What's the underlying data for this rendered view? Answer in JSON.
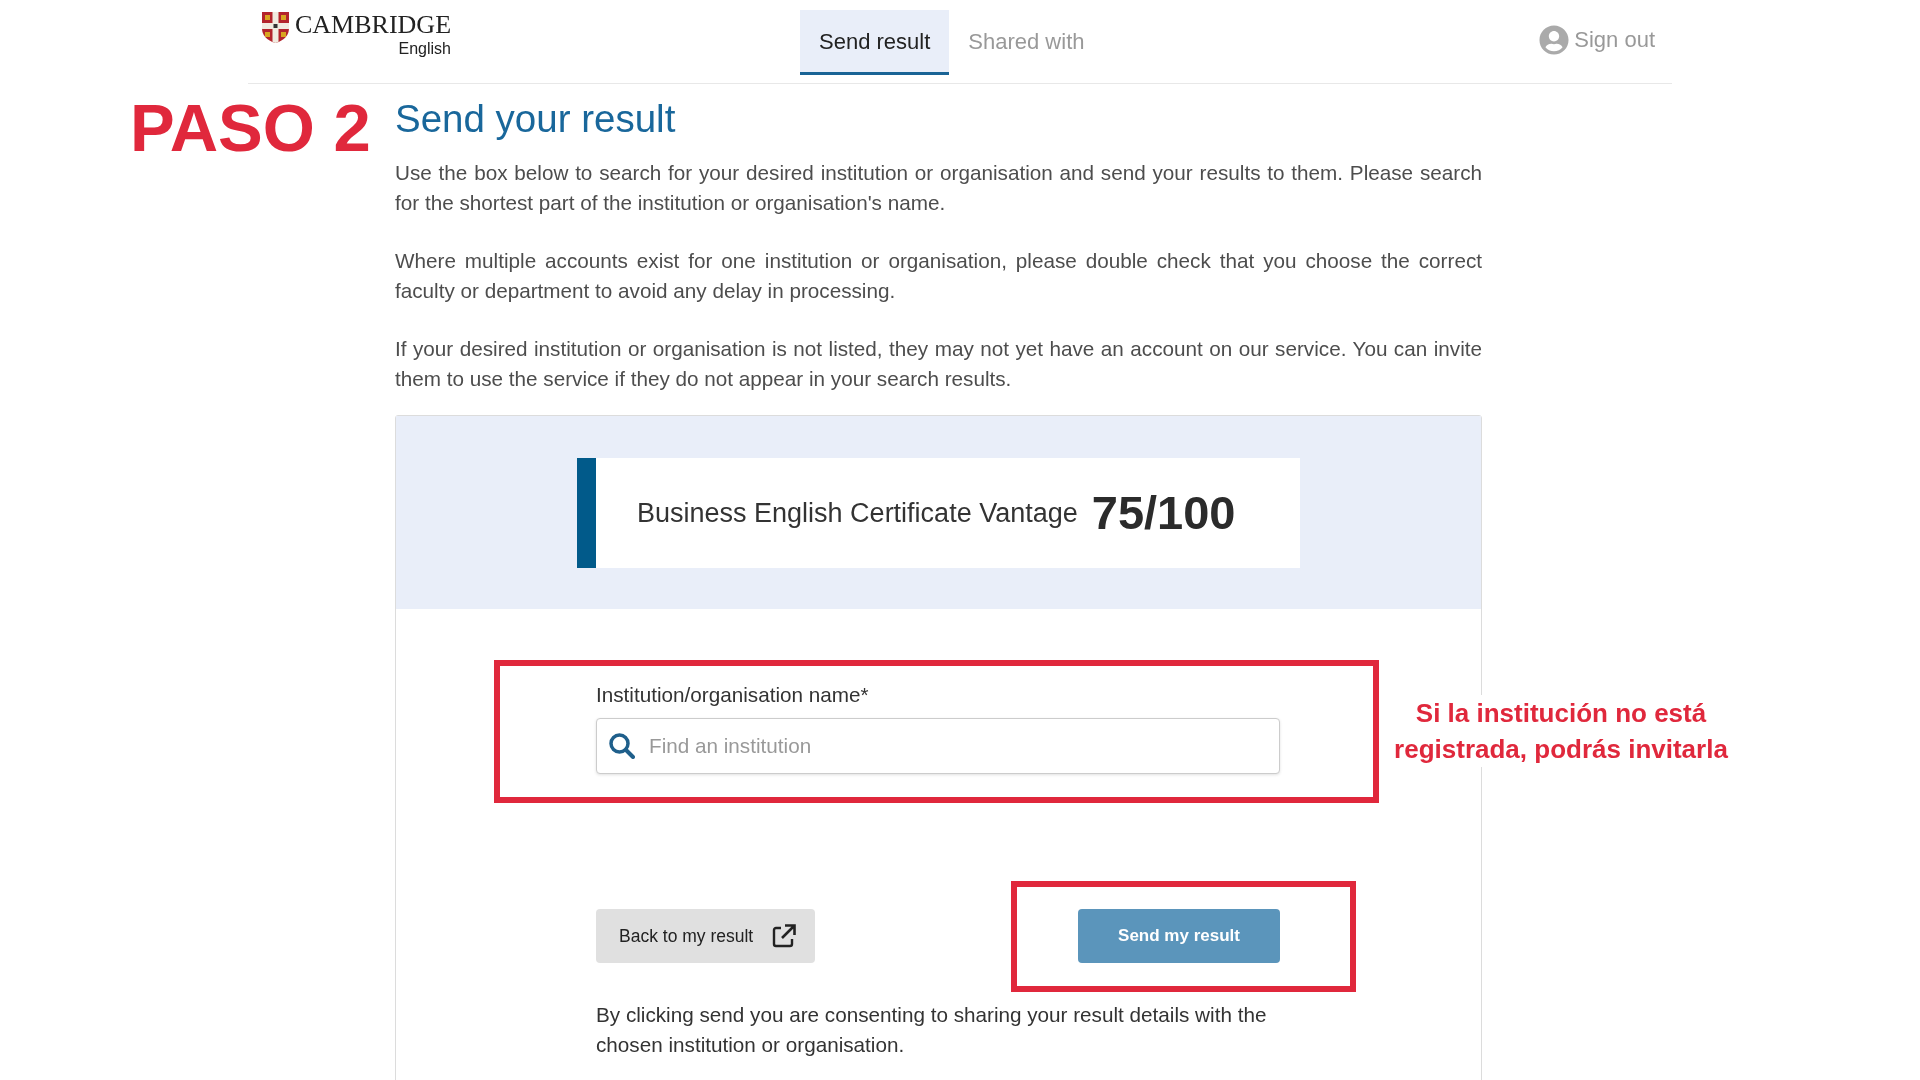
{
  "header": {
    "logo": {
      "name": "CAMBRIDGE",
      "subtitle": "English"
    },
    "tabs": [
      {
        "label": "Send result",
        "selected": true
      },
      {
        "label": "Shared with",
        "selected": false
      }
    ],
    "sign_out": "Sign out"
  },
  "annotations": {
    "step_label": "PASO 2",
    "note": "Si la institución no está registrada, podrás invitarla"
  },
  "page": {
    "title": "Send your result",
    "paragraphs": [
      "Use the box below to search for your desired institution or organisation and send your results to them. Please search for the shortest part of the institution or organisation's name.",
      "Where multiple accounts exist for one institution or organisation, please double check that you choose the correct faculty or department to avoid any delay in processing.",
      "If your desired institution or organisation is not listed, they may not yet have an account on our service. You can invite them to use the service if they do not appear in your search results."
    ]
  },
  "result_card": {
    "exam": "Business English Certificate Vantage",
    "score": "75/100"
  },
  "form": {
    "label": "Institution/organisation name*",
    "search": {
      "placeholder": "Find an institution"
    },
    "highlighted": true
  },
  "buttons": [
    {
      "label": "Back to my result",
      "kind": "secondary",
      "highlighted": false
    },
    {
      "label": "Send my result",
      "kind": "primary",
      "highlighted": true
    }
  ],
  "consent": "By clicking send you are consenting to sharing your result details with the chosen institution or organisation."
}
